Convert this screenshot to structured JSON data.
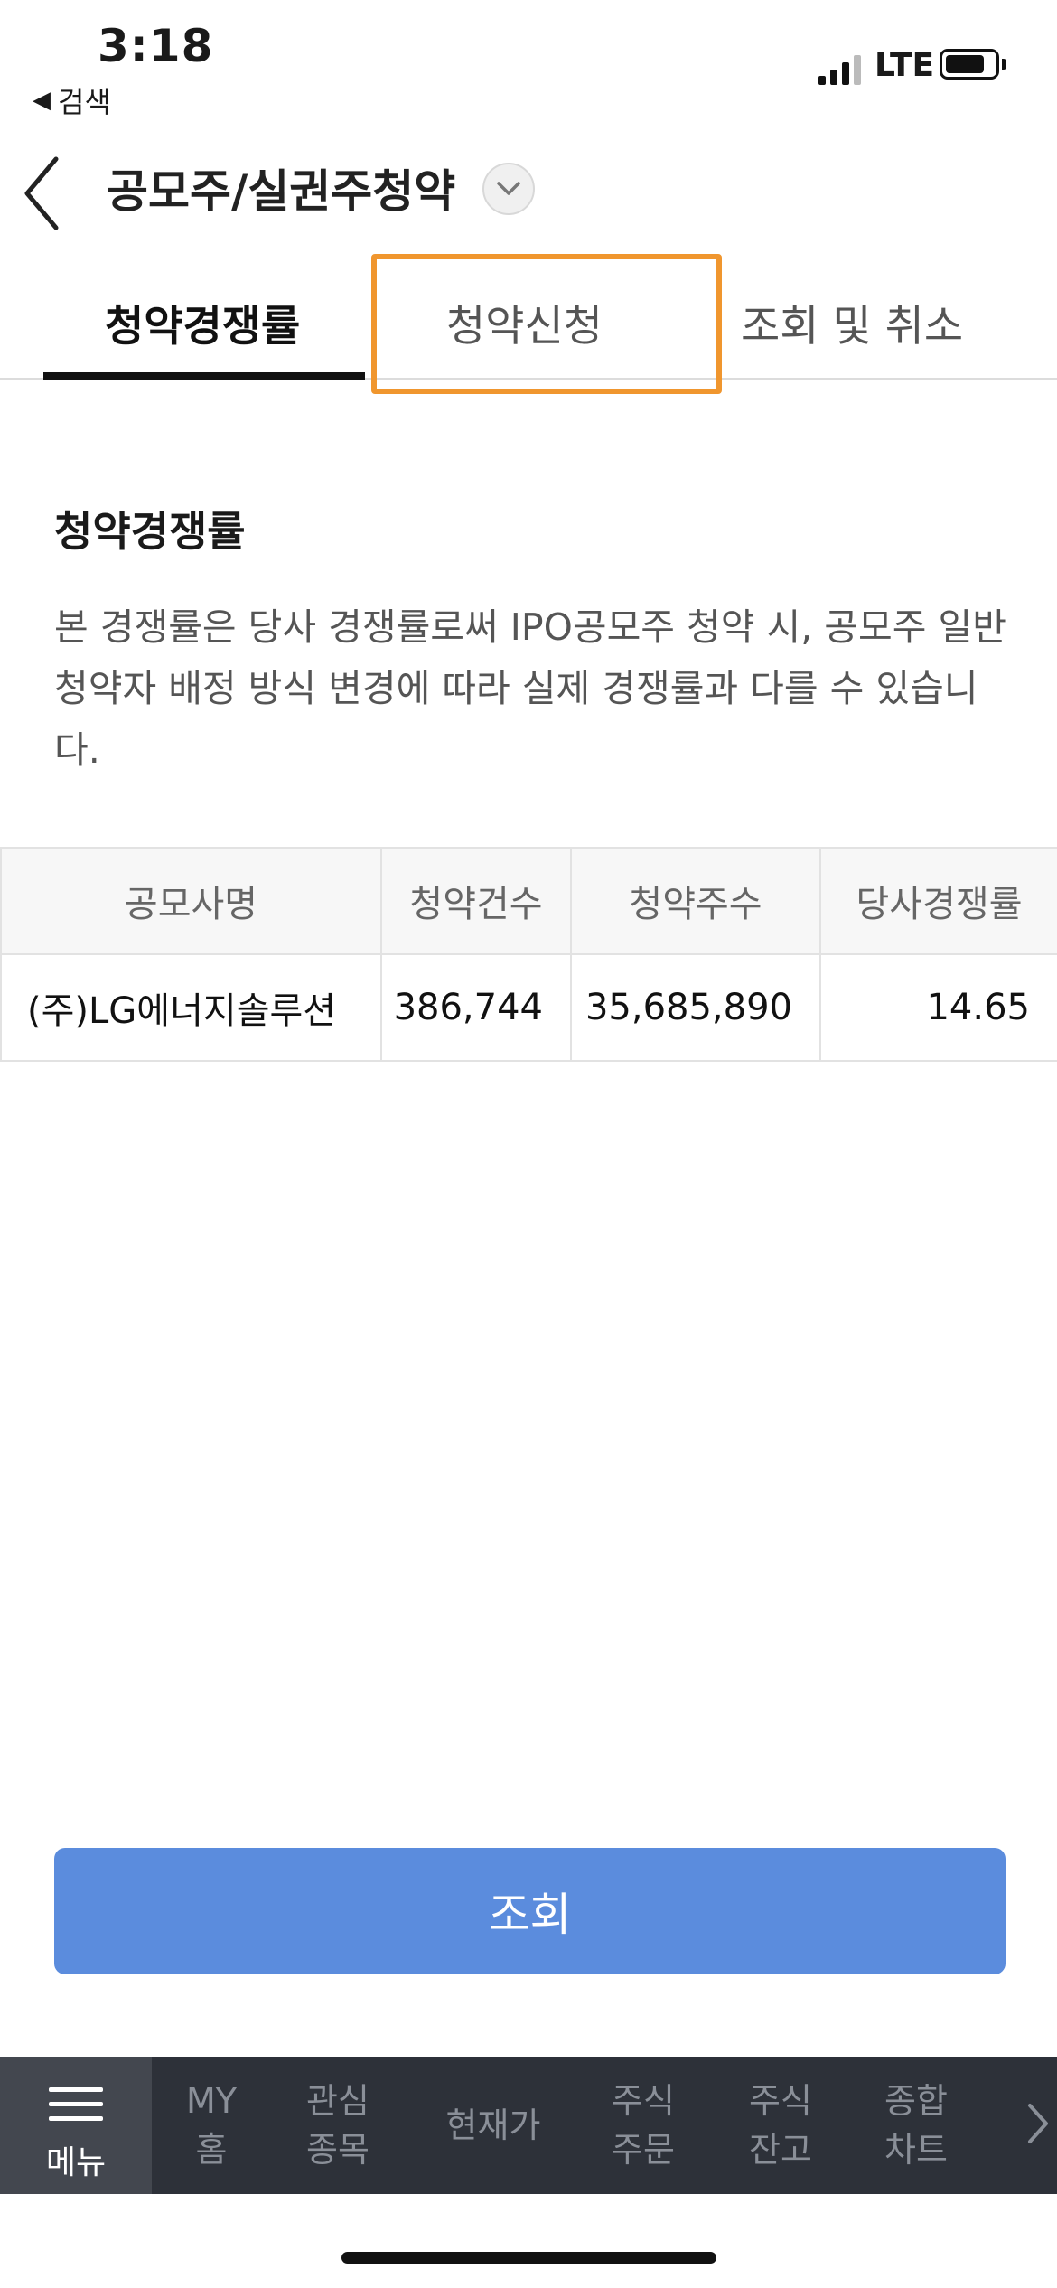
{
  "status_bar": {
    "time": "3:18",
    "back_app": "검색",
    "network": "LTE"
  },
  "header": {
    "title": "공모주/실권주청약"
  },
  "tabs": [
    {
      "label": "청약경쟁률",
      "active": true
    },
    {
      "label": "청약신청",
      "active": false,
      "highlighted": true
    },
    {
      "label": "조회 및 취소",
      "active": false
    }
  ],
  "section": {
    "title": "청약경쟁률",
    "notice": "본 경쟁률은 당사 경쟁률로써 IPO공모주 청약 시, 공모주 일반청약자 배정 방식 변경에 따라 실제 경쟁률과 다를 수 있습니다."
  },
  "table": {
    "headers": [
      "공모사명",
      "청약건수",
      "청약주수",
      "당사경쟁률"
    ],
    "rows": [
      [
        "(주)LG에너지솔루션",
        "386,744",
        "35,685,890",
        "14.65"
      ]
    ]
  },
  "query_button": "조회",
  "bottom_nav": {
    "menu_label": "메뉴",
    "items": [
      "MY\n홈",
      "관심\n종목",
      "현재가",
      "주식\n주문",
      "주식\n잔고",
      "종합\n차트"
    ]
  },
  "colors": {
    "accent": "#5b8cdd",
    "highlight": "#f0962e",
    "nav_bg": "#2d3139"
  }
}
